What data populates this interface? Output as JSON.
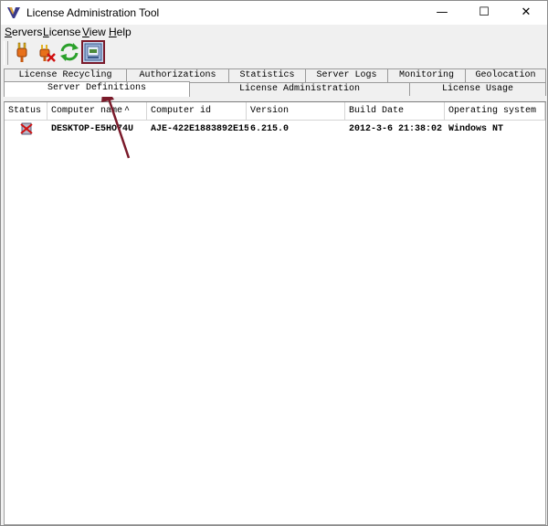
{
  "window": {
    "title": "License Administration Tool",
    "minimize": "—",
    "maximize": "☐",
    "close": "✕"
  },
  "menu": {
    "items": [
      {
        "accel": "S",
        "rest": "ervers"
      },
      {
        "accel": "L",
        "rest": "icense"
      },
      {
        "accel": "V",
        "rest": "iew"
      },
      {
        "accel": "H",
        "rest": "elp"
      }
    ]
  },
  "toolbar": {
    "buttons": [
      {
        "icon": "plug-connect-icon"
      },
      {
        "icon": "plug-disconnect-icon"
      },
      {
        "icon": "refresh-icon"
      },
      {
        "icon": "properties-icon",
        "active": true
      }
    ]
  },
  "tabs": {
    "row1": [
      "License Recycling",
      "Authorizations",
      "Statistics",
      "Server Logs",
      "Monitoring",
      "Geolocation"
    ],
    "row2": [
      "Server Definitions",
      "License Administration",
      "License Usage"
    ],
    "selected": "Server Definitions"
  },
  "table": {
    "columns": [
      "Status",
      "Computer name",
      "Computer id",
      "Version",
      "Build Date",
      "Operating system"
    ],
    "sort_indicator": "^",
    "rows": [
      {
        "status_icon": "disconnected-server-icon",
        "computer_name": "DESKTOP-E5HO74U",
        "computer_id": "AJE-422E1883892E15",
        "version": "6.215.0",
        "build_date": "2012-3-6 21:38:02",
        "os": "Windows NT"
      }
    ]
  },
  "colors": {
    "annotation_arrow": "#7a1a2a",
    "selected_toolbar_border": "#7a1a2a"
  }
}
